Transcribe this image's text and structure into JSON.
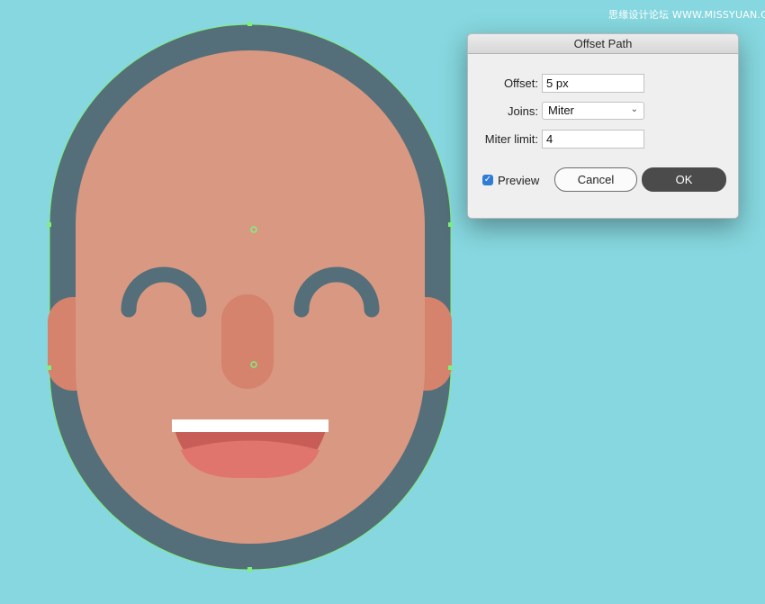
{
  "watermark": "思缘设计论坛 WWW.MISSYUAN.COM",
  "colors": {
    "canvas": "#86d7df",
    "hair": "#546f79",
    "skin": "#d99882",
    "ear": "#d5836d",
    "nose": "#d5836d",
    "mouth_top": "#c75d56",
    "tongue": "#e0756d",
    "teeth": "#ffffff",
    "selection": "#7ef07e"
  },
  "dialog": {
    "title": "Offset Path",
    "offset_label": "Offset:",
    "offset_value": "5 px",
    "joins_label": "Joins:",
    "joins_value": "Miter",
    "miter_label": "Miter limit:",
    "miter_value": "4",
    "preview_label": "Preview",
    "preview_checked": true,
    "cancel_label": "Cancel",
    "ok_label": "OK"
  }
}
